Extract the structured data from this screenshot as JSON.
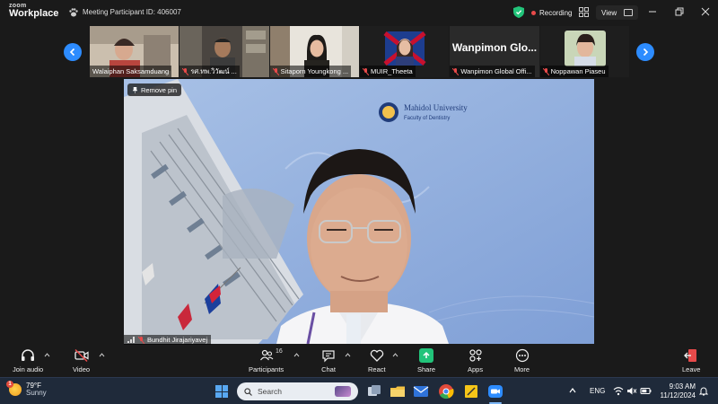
{
  "app": {
    "logo_top": "zoom",
    "logo_bottom": "Workplace",
    "meeting_id": "Meeting Participant ID: 406007",
    "recording_label": "Recording",
    "view_label": "View"
  },
  "participants_strip": [
    {
      "name": "Walaiphan Saksamduang",
      "muted": false
    },
    {
      "name": "รศ.ทพ.วิวัฒน์ ...",
      "muted": true
    },
    {
      "name": "Sitaporn Youngkong ...",
      "muted": true
    },
    {
      "name": "MUIR_Theeta",
      "muted": true
    },
    {
      "name": "Wanpimon Global Offi...",
      "muted": true,
      "big_label": "Wanpimon  Glo..."
    },
    {
      "name": "Noppawan Piaseu",
      "muted": true
    }
  ],
  "main_video": {
    "remove_pin_label": "Remove pin",
    "speaker_name": "Bundhit Jirajariyavej",
    "background_logo_title": "Mahidol University",
    "background_logo_subtitle": "Faculty of Dentistry"
  },
  "toolbar": {
    "join_audio": "Join audio",
    "video": "Video",
    "participants": "Participants",
    "participants_count": "16",
    "chat": "Chat",
    "react": "React",
    "share": "Share",
    "apps": "Apps",
    "more": "More",
    "leave": "Leave"
  },
  "taskbar": {
    "weather_temp": "79°F",
    "weather_cond": "Sunny",
    "weather_badge": "1",
    "search_placeholder": "Search",
    "language": "ENG",
    "time": "9:03 AM",
    "date": "11/12/2024"
  },
  "colors": {
    "zoom_blue": "#2d8cff",
    "share_green": "#22c47a",
    "leave_red": "#e84a4a"
  }
}
